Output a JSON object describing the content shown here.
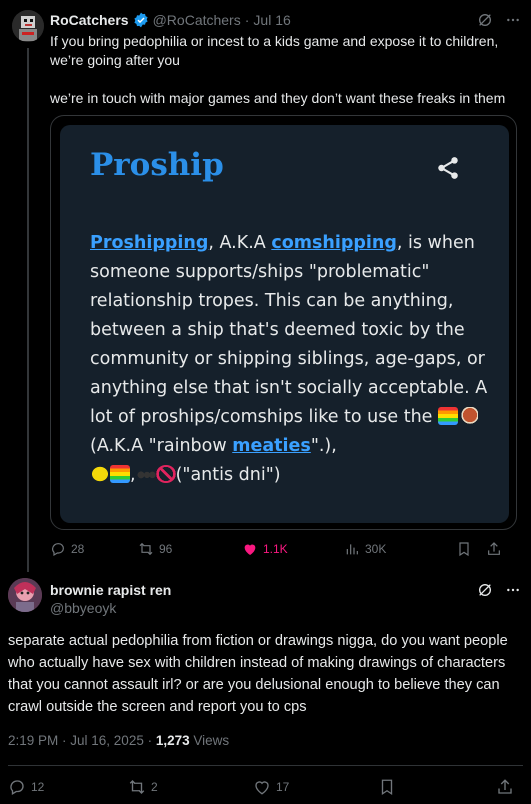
{
  "tweet1": {
    "name": "RoCatchers",
    "handle": "@RoCatchers",
    "sep": "·",
    "date": "Jul 16",
    "text_lines": [
      "If you bring pedophilia or incest to a kids game and expose it to children,",
      "we’re going after you",
      "we’re in touch with major games and they don’t want these freaks in them"
    ],
    "card": {
      "title": "Proship",
      "link1": "Proshipping",
      "t1": ", A.K.A ",
      "link2": "comshipping",
      "t2": ", is when someone supports/ships \"problematic\" relationship tropes. This can be anything, between a ship that's deemed toxic by the community or shipping siblings, age-gaps, or anything else that isn't socially acceptable. A lot of proships/comships like to use the ",
      "t3": "(A.K.A \"rainbow ",
      "link3": "meaties",
      "t4": "\".),",
      "t5": ",",
      "t6": "(\"antis dni\")"
    },
    "actions": {
      "replies": "28",
      "reposts": "96",
      "likes": "1.1K",
      "views": "30K"
    },
    "like_color": "#f91880"
  },
  "tweet2": {
    "name": "brownie rapist ren",
    "handle": "@bbyeoyk",
    "text": "separate actual pedophilia from fiction or drawings nigga, do you want people who actually have sex with children instead of making drawings of characters that you cannot assault irl? or are you delusional enough to believe they can crawl outside the screen and report you to cps",
    "time": "2:19 PM · Jul 16, 2025 · ",
    "views_count": "1,273",
    "views_label": " Views",
    "actions": {
      "replies": "12",
      "reposts": "2",
      "likes": "17"
    }
  },
  "colors": {
    "accent": "#1d9bf0",
    "muted": "#71767b",
    "card_bg": "#15202b",
    "card_title": "#2b8fe8"
  }
}
